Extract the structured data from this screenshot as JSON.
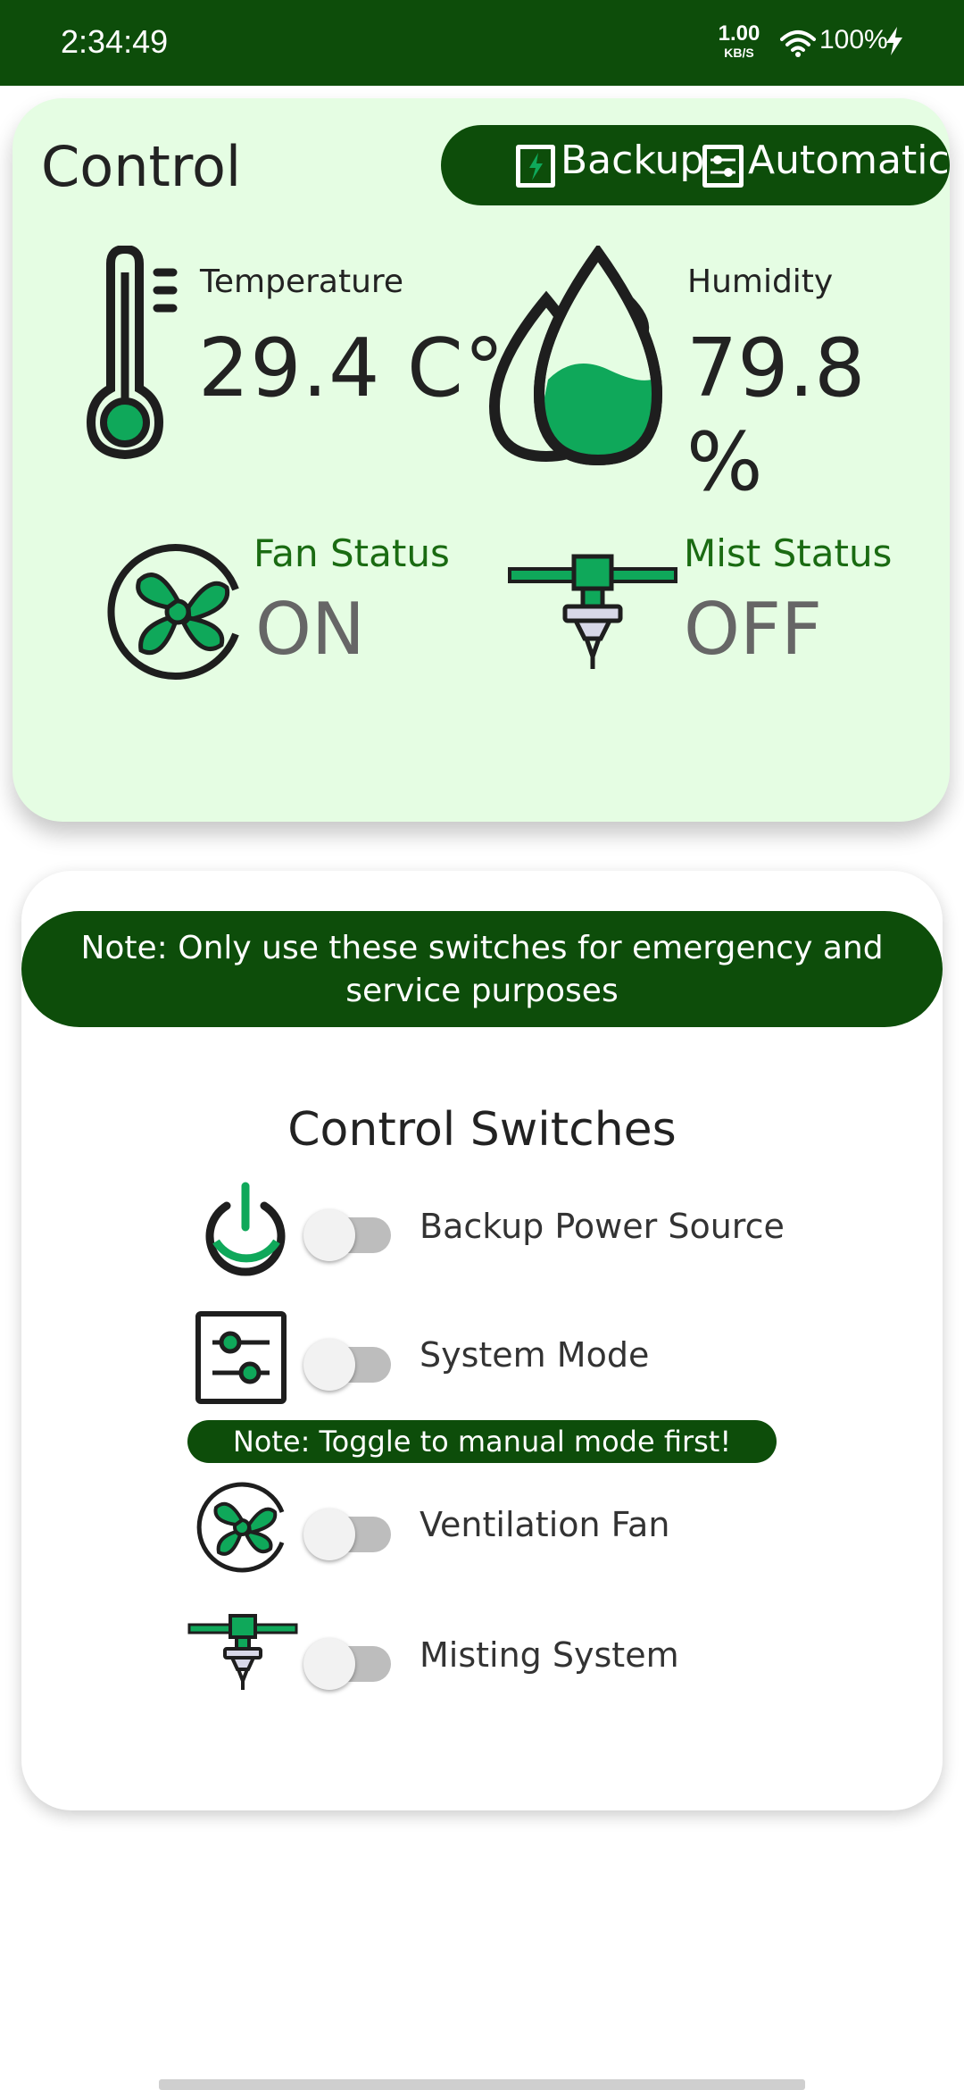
{
  "status_bar": {
    "time": "2:34:49",
    "net_speed_value": "1.00",
    "net_speed_unit": "KB/S",
    "battery": "100%"
  },
  "control_card": {
    "title": "Control",
    "mode_pill": {
      "backup_label": "Backup",
      "automatic_label": "Automatic"
    },
    "temperature": {
      "label": "Temperature",
      "value": "29.4  C°"
    },
    "humidity": {
      "label": "Humidity",
      "value": "79.8 %"
    },
    "fan": {
      "label": "Fan Status",
      "value": "ON"
    },
    "mist": {
      "label": "Mist Status",
      "value": "OFF"
    }
  },
  "switches_card": {
    "note": "Note: Only use these switches for emergency and service purposes",
    "title": "Control Switches",
    "manual_note": "Note: Toggle to manual mode first!",
    "switches": [
      {
        "label": "Backup Power Source",
        "on": false,
        "icon": "power-icon"
      },
      {
        "label": "System Mode",
        "on": false,
        "icon": "sliders-icon"
      },
      {
        "label": "Ventilation Fan",
        "on": false,
        "icon": "fan-icon"
      },
      {
        "label": "Misting System",
        "on": false,
        "icon": "sprinkler-icon"
      }
    ]
  },
  "colors": {
    "primary_dark_green": "#0d4d0a",
    "accent_green": "#0fa85a",
    "card_bg": "#e5fde3",
    "status_label_green": "#1a6b12"
  }
}
